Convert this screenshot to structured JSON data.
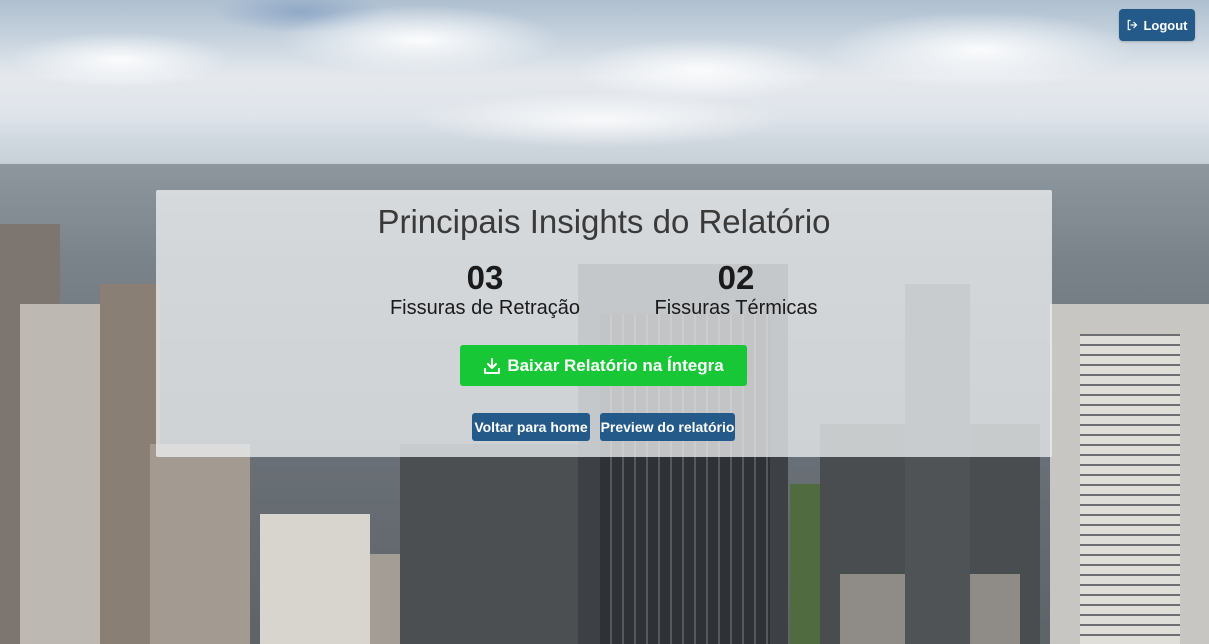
{
  "header": {
    "logout_label": "Logout",
    "logout_icon": "logout-icon"
  },
  "card": {
    "title": "Principais Insights do Relatório",
    "stats": [
      {
        "value": "03",
        "label": "Fissuras de Retração"
      },
      {
        "value": "02",
        "label": "Fissuras Térmicas"
      }
    ],
    "download_label": "Baixar Relatório na Íntegra",
    "download_icon": "download-icon",
    "home_label": "Voltar para home",
    "preview_label": "Preview do relatório"
  },
  "colors": {
    "primary": "#245a8a",
    "success": "#18c736",
    "card_bg": "#eceef0"
  }
}
